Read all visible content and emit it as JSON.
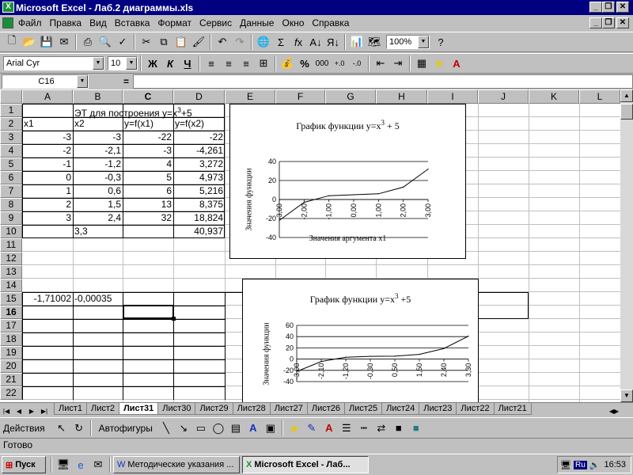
{
  "window": {
    "title": "Microsoft Excel - Лаб.2 диаграммы.xls"
  },
  "menu": [
    "Файл",
    "Правка",
    "Вид",
    "Вставка",
    "Формат",
    "Сервис",
    "Данные",
    "Окно",
    "Справка"
  ],
  "toolbar": {
    "zoom": "100%"
  },
  "format_toolbar": {
    "font": "Arial Cyr",
    "size": "10",
    "bold": "Ж",
    "italic": "К",
    "underline": "Ч",
    "percent": "%",
    "thousands": "000"
  },
  "formula_bar": {
    "name_box": "C16",
    "equals": "="
  },
  "columns": [
    "A",
    "B",
    "C",
    "D",
    "E",
    "F",
    "G",
    "H",
    "I",
    "J",
    "K",
    "L"
  ],
  "rows": [
    "1",
    "2",
    "3",
    "4",
    "5",
    "6",
    "7",
    "8",
    "9",
    "10",
    "11",
    "12",
    "13",
    "14",
    "15",
    "16",
    "17",
    "18",
    "19",
    "20",
    "21",
    "22"
  ],
  "cells": {
    "B1": "ЭТ для построения y=x",
    "B1_sup": "3",
    "B1_tail": "+5",
    "A2": "x1",
    "B2": "x2",
    "C2": "y=f(x1)",
    "D2": "y=f(x2)",
    "A3": "-3",
    "B3": "-3",
    "C3": "-22",
    "D3": "-22",
    "A4": "-2",
    "B4": "-2,1",
    "C4": "-3",
    "D4": "-4,261",
    "A5": "-1",
    "B5": "-1,2",
    "C5": "4",
    "D5": "3,272",
    "A6": "0",
    "B6": "-0,3",
    "C6": "5",
    "D6": "4,973",
    "A7": "1",
    "B7": "0,6",
    "C7": "6",
    "D7": "5,216",
    "A8": "2",
    "B8": "1,5",
    "C8": "13",
    "D8": "8,375",
    "A9": "3",
    "B9": "2,4",
    "C9": "32",
    "D9": "18,824",
    "B10": "3,3",
    "D10": "40,937",
    "A15": "-1,71002",
    "B15": "-0,00035"
  },
  "chart_data": [
    {
      "type": "line",
      "title": "График функции y=x",
      "title_sup": "3",
      "title_tail": " + 5",
      "xlabel": "Значения аргумента x1",
      "ylabel": "Значения функции",
      "categories": [
        "-3,00",
        "-2,00",
        "-1,00",
        "0,00",
        "1,00",
        "2,00",
        "3,00"
      ],
      "values": [
        -22,
        -3,
        4,
        5,
        6,
        13,
        32
      ],
      "ylim": [
        -40,
        40
      ],
      "yticks": [
        "40",
        "20",
        "0",
        "-20",
        "-40"
      ],
      "grid": true
    },
    {
      "type": "line",
      "title": "График функции y=x",
      "title_sup": "3",
      "title_tail": " +5",
      "ylabel": "Значения функции",
      "categories": [
        "-3,00",
        "-2,10",
        "-1,20",
        "-0,30",
        "0,50",
        "1,50",
        "2,40",
        "3,30"
      ],
      "values": [
        -22,
        -4.261,
        3.272,
        4.973,
        5.216,
        8.375,
        18.824,
        40.937
      ],
      "ylim": [
        -40,
        60
      ],
      "yticks": [
        "60",
        "40",
        "20",
        "0",
        "-20",
        "-40"
      ],
      "grid": true
    }
  ],
  "sheet_tabs": [
    "Лист1",
    "Лист2",
    "Лист31",
    "Лист30",
    "Лист29",
    "Лист28",
    "Лист27",
    "Лист26",
    "Лист25",
    "Лист24",
    "Лист23",
    "Лист22",
    "Лист21"
  ],
  "active_tab": "Лист31",
  "drawing": {
    "actions": "Действия",
    "autoshapes": "Автофигуры"
  },
  "status": "Готово",
  "taskbar": {
    "start": "Пуск",
    "task1": "Методические указания ...",
    "task2": "Microsoft Excel - Лаб...",
    "lang": "Ru",
    "time": "16:53"
  }
}
